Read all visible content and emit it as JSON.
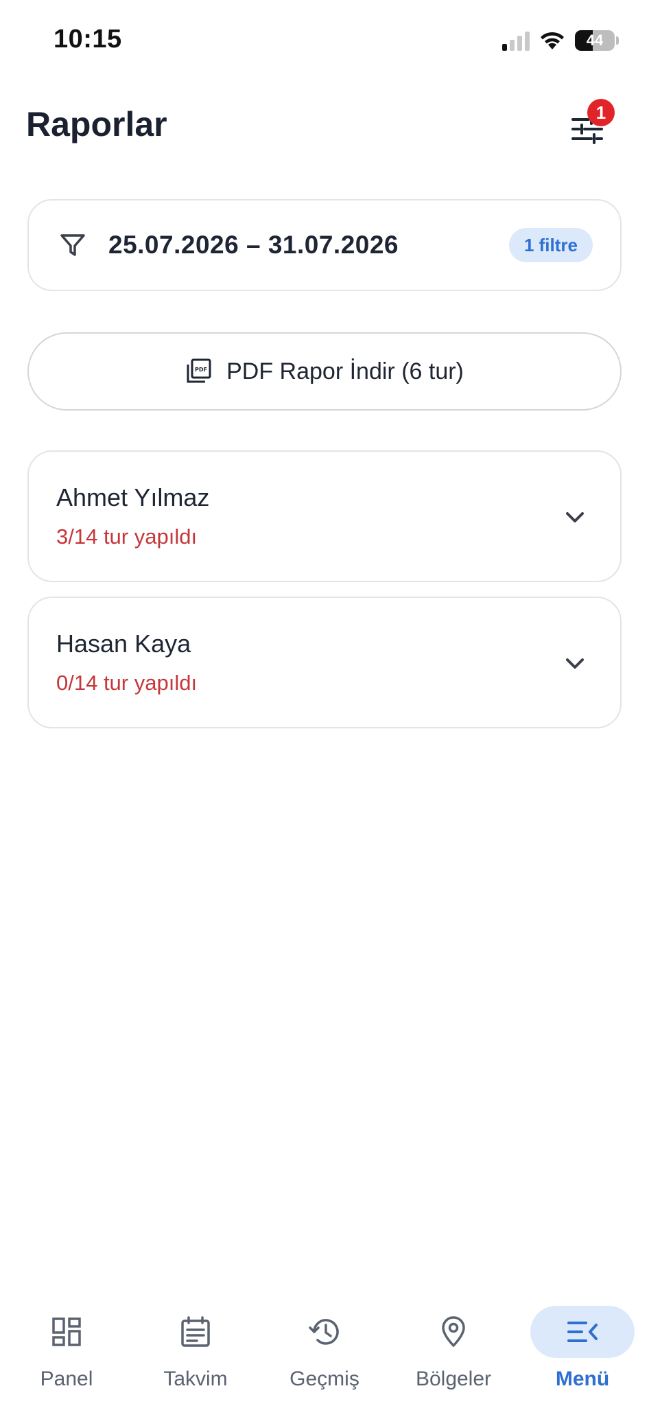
{
  "status_bar": {
    "time": "10:15",
    "battery": "44",
    "icons": [
      "signal-icon",
      "wifi-icon",
      "battery-icon"
    ]
  },
  "header": {
    "title": "Raporlar",
    "filter_icon": "sliders-icon",
    "filter_badge": "1"
  },
  "date_filter": {
    "icon": "funnel-icon",
    "range": "25.07.2026 – 31.07.2026",
    "chip": "1 filtre"
  },
  "pdf_button": {
    "icon": "pdf-icon",
    "label": "PDF Rapor İndir (6 tur)"
  },
  "staff": [
    {
      "name": "Ahmet Yılmaz",
      "progress": "3/14 tur yapıldı"
    },
    {
      "name": "Hasan Kaya",
      "progress": "0/14 tur yapıldı"
    }
  ],
  "bottom_nav": {
    "items": [
      {
        "label": "Panel",
        "icon": "dashboard-icon"
      },
      {
        "label": "Takvim",
        "icon": "calendar-icon"
      },
      {
        "label": "Geçmiş",
        "icon": "history-icon"
      },
      {
        "label": "Bölgeler",
        "icon": "location-pin-icon"
      },
      {
        "label": "Menü",
        "icon": "menu-collapse-icon",
        "active": true
      }
    ]
  },
  "colors": {
    "accent": "#2e6fd0",
    "accent_light": "#dbe9fb",
    "badge": "#e0242a",
    "progress_text": "#c6363a",
    "text_primary": "#1e2533"
  }
}
